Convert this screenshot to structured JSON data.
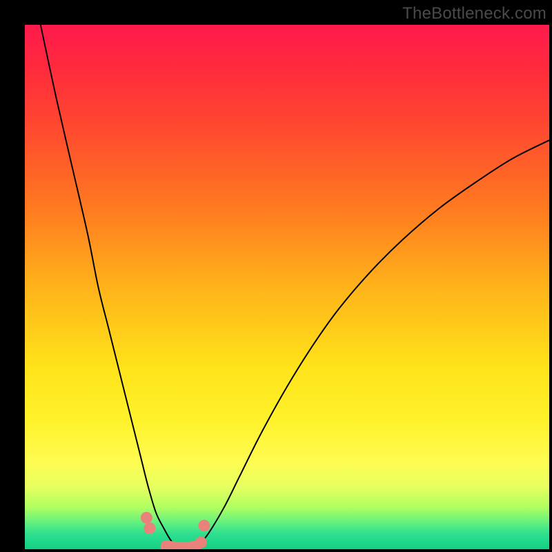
{
  "watermark": "TheBottleneck.com",
  "chart_data": {
    "type": "line",
    "title": "",
    "xlabel": "",
    "ylabel": "",
    "xlim": [
      0,
      100
    ],
    "ylim": [
      0,
      100
    ],
    "grid": false,
    "legend": false,
    "series": [
      {
        "name": "left-curve",
        "color": "#000000",
        "x": [
          3,
          6,
          9,
          12,
          14,
          16,
          18,
          20,
          22,
          23.5,
          25,
          26.5,
          28,
          29.5
        ],
        "y": [
          100,
          86,
          73,
          60,
          50,
          42,
          34,
          26,
          18,
          12,
          7,
          4,
          1.5,
          0.5
        ]
      },
      {
        "name": "right-curve",
        "color": "#000000",
        "x": [
          33,
          35,
          38,
          41,
          45,
          50,
          55,
          60,
          66,
          72,
          79,
          86,
          93,
          100
        ],
        "y": [
          0.5,
          3,
          8,
          14,
          22,
          31,
          39,
          46,
          53,
          59,
          65,
          70,
          74.5,
          78
        ]
      },
      {
        "name": "bottom-dots",
        "color": "#e9827a",
        "type": "scatter",
        "x": [
          23.2,
          23.8,
          27,
          29,
          31,
          32.5,
          33.6,
          34.2
        ],
        "y": [
          6,
          4,
          0.6,
          0.3,
          0.3,
          0.5,
          1.3,
          4.5
        ]
      }
    ],
    "annotations": []
  }
}
